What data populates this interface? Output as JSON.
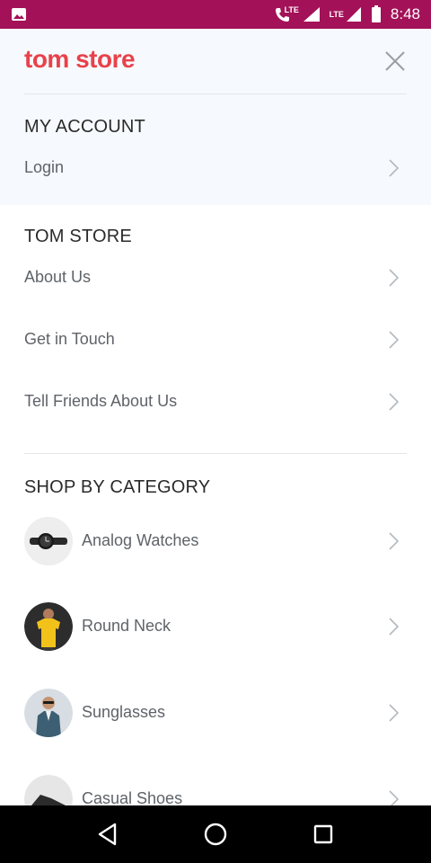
{
  "status_bar": {
    "time": "8:48",
    "lte_label_1": "LTE",
    "lte_label_2": "LTE",
    "icons": [
      "image-icon",
      "volte-call-icon",
      "signal-icon",
      "lte-signal-icon",
      "battery-icon"
    ]
  },
  "header": {
    "brand": "tom store",
    "close_icon": "close-icon",
    "brand_color": "#e8424a"
  },
  "account": {
    "title": "MY ACCOUNT",
    "items": [
      {
        "label": "Login"
      }
    ]
  },
  "store": {
    "title": "TOM STORE",
    "items": [
      {
        "label": "About Us"
      },
      {
        "label": "Get in Touch"
      },
      {
        "label": "Tell Friends About Us"
      }
    ]
  },
  "categories": {
    "title": "SHOP BY CATEGORY",
    "items": [
      {
        "label": "Analog Watches",
        "thumb": "watch-thumbnail"
      },
      {
        "label": "Round Neck",
        "thumb": "tshirt-thumbnail"
      },
      {
        "label": "Sunglasses",
        "thumb": "sunglasses-thumbnail"
      },
      {
        "label": "Casual Shoes",
        "thumb": "shoes-thumbnail"
      }
    ]
  },
  "nav_bar": {
    "icons": [
      "back-icon",
      "home-icon",
      "recents-icon"
    ]
  },
  "colors": {
    "status_bar": "#a31258",
    "panel_bg": "#f6f9fd",
    "text": "#5f6368"
  }
}
